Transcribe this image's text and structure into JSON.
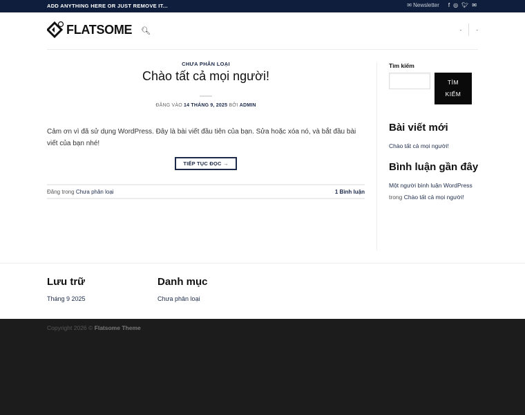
{
  "topbar": {
    "message": "ADD ANYTHING HERE OR JUST REMOVE IT...",
    "newsletter": "Newsletter"
  },
  "header": {
    "logo": "FLATSOME",
    "nav_right": [
      "-",
      "-"
    ]
  },
  "post": {
    "category": "CHƯA PHÂN LOẠI",
    "title": "Chào tất cả mọi người!",
    "meta_prefix": "ĐĂNG VÀO",
    "date": "14 THÁNG 9, 2025",
    "meta_by": "BỞI",
    "author": "ADMIN",
    "excerpt": "Cảm ơn vì đã sử dụng WordPress. Đây là bài viết đầu tiên của bạn. Sửa hoặc xóa nó, và bắt đầu bài viết của bạn nhé!",
    "read_more": "TIẾP TỤC ĐỌC →",
    "posted_in": "Đăng trong",
    "posted_cat": "Chưa phân loại",
    "comments": "1 Bình luận"
  },
  "sidebar": {
    "search_label": "Tìm kiếm",
    "search_value": "",
    "search_btn_1": "TÌM",
    "search_btn_2": "KIẾM",
    "recent_title": "Bài viết mới",
    "recent_post": "Chào tất cả mọi người!",
    "comments_title": "Bình luận gần đây",
    "comment_author": "Một người bình luận WordPress",
    "comment_in": "trong",
    "comment_post": "Chào tất cả mọi người!"
  },
  "bottom": {
    "archive_title": "Lưu trữ",
    "archive_item": "Tháng 9 2025",
    "cat_title": "Danh mục",
    "cat_item": "Chưa phân loại"
  },
  "footer": {
    "copyright": "Copyright 2026 ©",
    "theme": "Flatsome Theme"
  }
}
